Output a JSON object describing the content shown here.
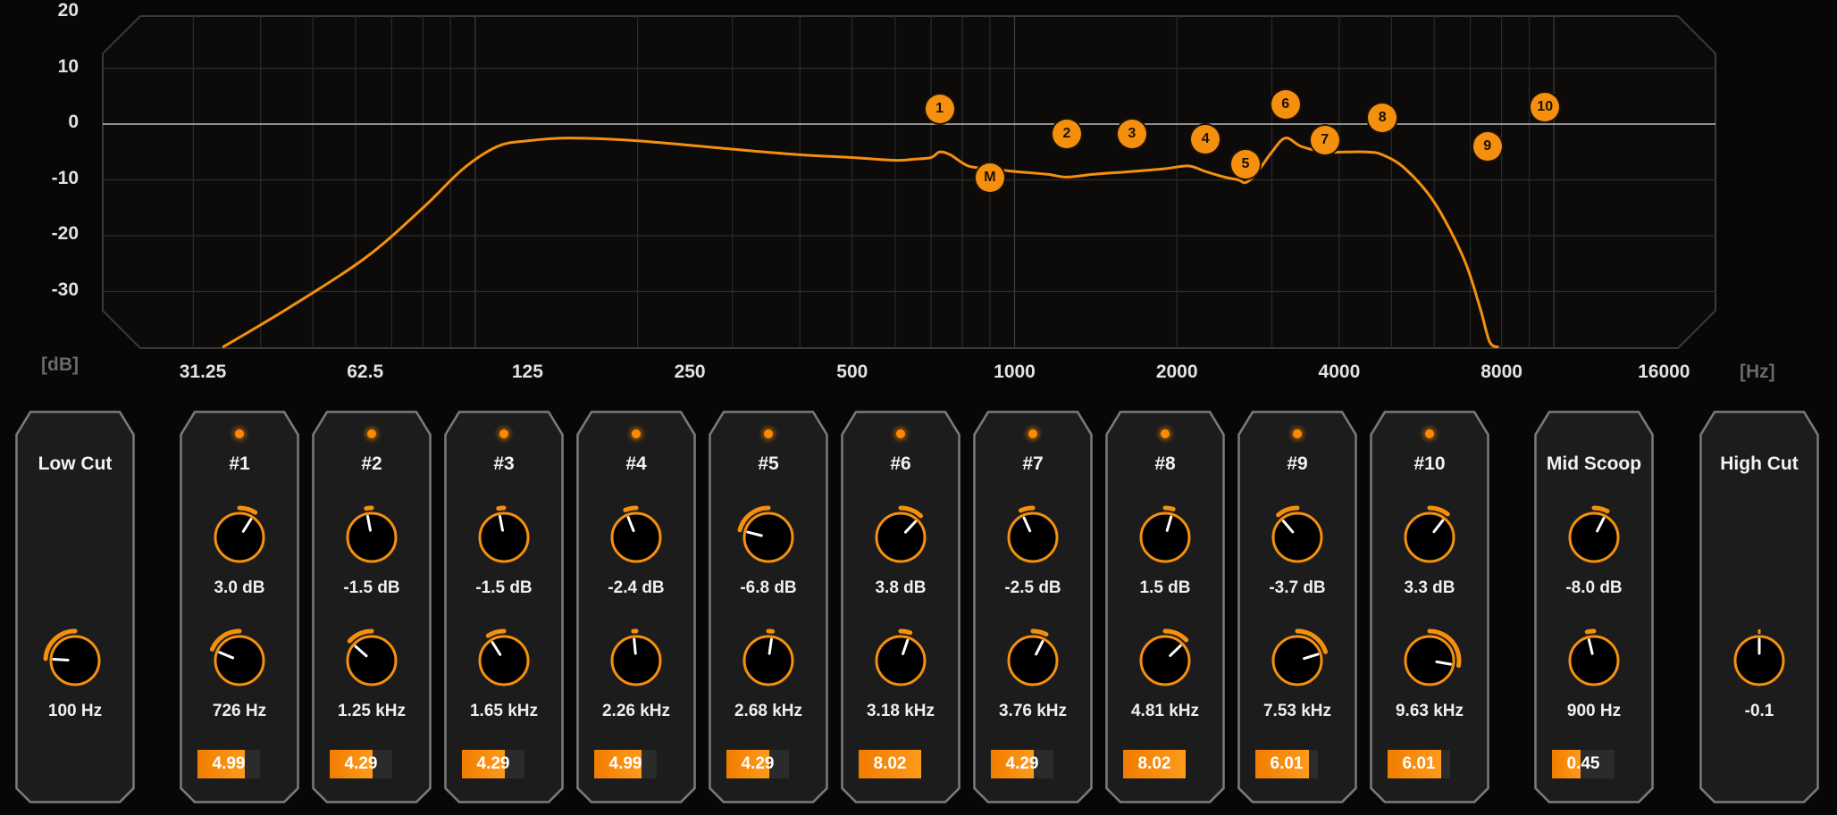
{
  "colors": {
    "accent": "#f5900f",
    "background": "#070707",
    "panel": "#1c1c1c",
    "grid": "#3a3a3a"
  },
  "graph": {
    "y_unit": "[dB]",
    "x_unit": "[Hz]",
    "y_ticks": [
      "20",
      "10",
      "0",
      "-10",
      "-20",
      "-30"
    ],
    "x_ticks": [
      "31.25",
      "62.5",
      "125",
      "250",
      "500",
      "1000",
      "2000",
      "4000",
      "8000",
      "16000"
    ],
    "markers": [
      {
        "label": "1",
        "freq": 726,
        "db": 3.0
      },
      {
        "label": "M",
        "freq": 900,
        "db": -8.0
      },
      {
        "label": "2",
        "freq": 1250,
        "db": -1.5
      },
      {
        "label": "3",
        "freq": 1650,
        "db": -1.5
      },
      {
        "label": "4",
        "freq": 2260,
        "db": -2.4
      },
      {
        "label": "5",
        "freq": 2680,
        "db": -6.8
      },
      {
        "label": "6",
        "freq": 3180,
        "db": 3.8
      },
      {
        "label": "7",
        "freq": 3760,
        "db": -2.5
      },
      {
        "label": "8",
        "freq": 4810,
        "db": 1.5
      },
      {
        "label": "9",
        "freq": 7530,
        "db": -3.7
      },
      {
        "label": "10",
        "freq": 9630,
        "db": 3.3
      }
    ]
  },
  "chart_data": {
    "type": "line",
    "title": "",
    "xlabel": "[Hz]",
    "ylabel": "[dB]",
    "xscale": "log",
    "xlim": [
      25,
      20000
    ],
    "ylim": [
      -40,
      20
    ],
    "grid": true,
    "series": [
      {
        "x": [
          34,
          45,
          62.5,
          80,
          95,
          110,
          125,
          150,
          200,
          300,
          400,
          500,
          600,
          650,
          700,
          726,
          760,
          820,
          900,
          1000,
          1150,
          1250,
          1400,
          1650,
          1900,
          2100,
          2260,
          2450,
          2600,
          2680,
          2800,
          3000,
          3180,
          3400,
          3760,
          4100,
          4500,
          4810,
          5300,
          6000,
          6800,
          7300,
          7600,
          7900
        ],
        "y": [
          -40,
          -33,
          -24,
          -15,
          -8,
          -4,
          -3,
          -2.5,
          -3,
          -4.5,
          -5.5,
          -6,
          -6.5,
          -6.3,
          -6,
          -5,
          -5.5,
          -7.5,
          -8,
          -8.5,
          -9,
          -9.5,
          -9,
          -8.5,
          -8,
          -7.5,
          -8.5,
          -9.5,
          -10,
          -10.5,
          -9,
          -5,
          -2.5,
          -4,
          -5,
          -5,
          -5,
          -5.5,
          -8,
          -14,
          -24,
          -33,
          -39,
          -40
        ]
      }
    ]
  },
  "strips": [
    {
      "title": "Low Cut",
      "knobs": [
        {
          "value": "100 Hz",
          "level": 0.18
        }
      ],
      "led": false
    },
    {
      "title": "#1",
      "knobs": [
        {
          "value": "3.0 dB",
          "level": 0.62
        },
        {
          "value": "726 Hz",
          "level": 0.25
        }
      ],
      "q": "4.99",
      "q_level": 0.75,
      "led": true
    },
    {
      "title": "#2",
      "knobs": [
        {
          "value": "-1.5 dB",
          "level": 0.46
        },
        {
          "value": "1.25 kHz",
          "level": 0.32
        }
      ],
      "q": "4.29",
      "q_level": 0.68,
      "led": true
    },
    {
      "title": "#3",
      "knobs": [
        {
          "value": "-1.5 dB",
          "level": 0.46
        },
        {
          "value": "1.65 kHz",
          "level": 0.38
        }
      ],
      "q": "4.29",
      "q_level": 0.68,
      "led": true
    },
    {
      "title": "#4",
      "knobs": [
        {
          "value": "-2.4 dB",
          "level": 0.42
        },
        {
          "value": "2.26 kHz",
          "level": 0.48
        }
      ],
      "q": "4.99",
      "q_level": 0.75,
      "led": true
    },
    {
      "title": "#5",
      "knobs": [
        {
          "value": "-6.8 dB",
          "level": 0.22
        },
        {
          "value": "2.68 kHz",
          "level": 0.53
        }
      ],
      "q": "4.29",
      "q_level": 0.68,
      "led": true
    },
    {
      "title": "#6",
      "knobs": [
        {
          "value": "3.8 dB",
          "level": 0.66
        },
        {
          "value": "3.18 kHz",
          "level": 0.57
        }
      ],
      "q": "8.02",
      "q_level": 1.0,
      "led": true
    },
    {
      "title": "#7",
      "knobs": [
        {
          "value": "-2.5 dB",
          "level": 0.41
        },
        {
          "value": "3.76 kHz",
          "level": 0.6
        }
      ],
      "q": "4.29",
      "q_level": 0.68,
      "led": true
    },
    {
      "title": "#8",
      "knobs": [
        {
          "value": "1.5 dB",
          "level": 0.56
        },
        {
          "value": "4.81 kHz",
          "level": 0.67
        }
      ],
      "q": "8.02",
      "q_level": 1.0,
      "led": true
    },
    {
      "title": "#9",
      "knobs": [
        {
          "value": "-3.7 dB",
          "level": 0.35
        },
        {
          "value": "7.53 kHz",
          "level": 0.77
        }
      ],
      "q": "6.01",
      "q_level": 0.85,
      "led": true
    },
    {
      "title": "#10",
      "knobs": [
        {
          "value": "3.3 dB",
          "level": 0.64
        },
        {
          "value": "9.63 kHz",
          "level": 0.87
        }
      ],
      "q": "6.01",
      "q_level": 0.85,
      "led": true
    },
    {
      "title": "Mid Scoop",
      "knobs": [
        {
          "value": "-8.0 dB",
          "level": 0.6
        },
        {
          "value": "900 Hz",
          "level": 0.45
        }
      ],
      "q": "0.45",
      "q_level": 0.45,
      "led": false
    },
    {
      "title": "High Cut",
      "knobs": [
        {
          "value": "-0.1",
          "level": 0.5
        }
      ],
      "led": false
    }
  ]
}
